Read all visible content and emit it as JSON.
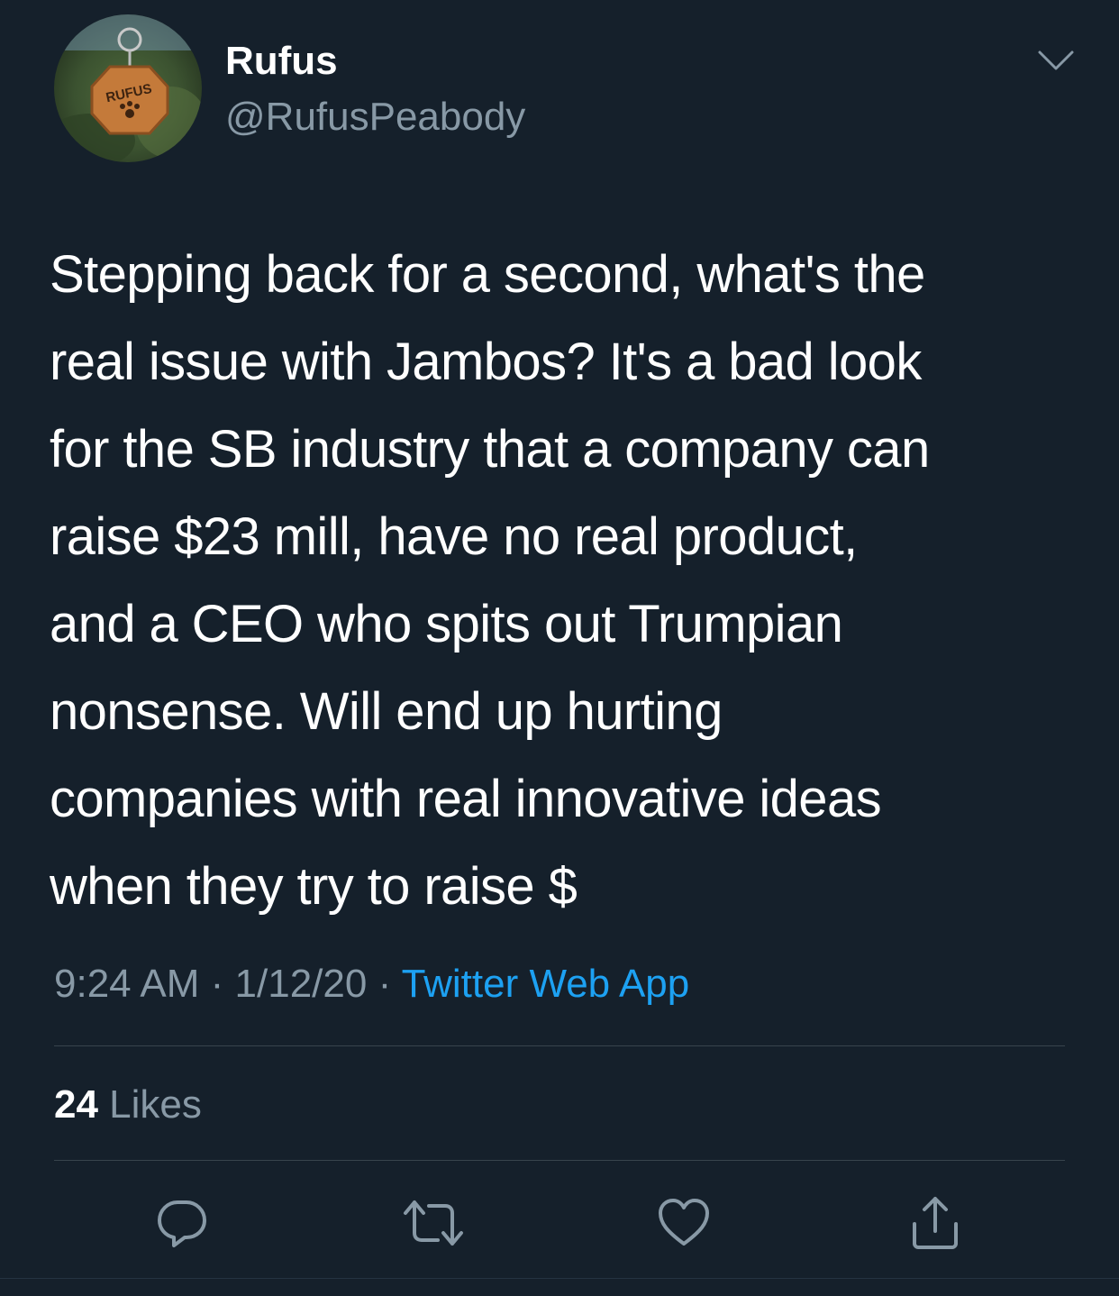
{
  "user": {
    "display_name": "Rufus",
    "handle": "@RufusPeabody",
    "avatar_tag_text": "RUFUS",
    "avatar_icon": "dog-tag-photo"
  },
  "tweet": {
    "text_lines": [
      "Stepping back for a second, what's the",
      "real issue with Jambos? It's a bad look",
      "for the SB industry that a company can",
      "raise $23 mill, have no real product,",
      "and a CEO who spits out Trumpian",
      "nonsense. Will end up hurting",
      "companies with real innovative ideas",
      "when they try to raise $"
    ],
    "time": "9:24 AM",
    "separator": " · ",
    "date": "1/12/20",
    "source": "Twitter Web App"
  },
  "stats": {
    "likes_count": "24",
    "likes_label": " Likes"
  },
  "actions": [
    {
      "name": "reply",
      "icon": "reply-icon"
    },
    {
      "name": "retweet",
      "icon": "retweet-icon"
    },
    {
      "name": "like",
      "icon": "heart-icon"
    },
    {
      "name": "share",
      "icon": "share-icon"
    }
  ],
  "colors": {
    "background": "#15202b",
    "text": "#ffffff",
    "secondary": "#8899a6",
    "link": "#1da1f2",
    "divider": "#38444d"
  }
}
